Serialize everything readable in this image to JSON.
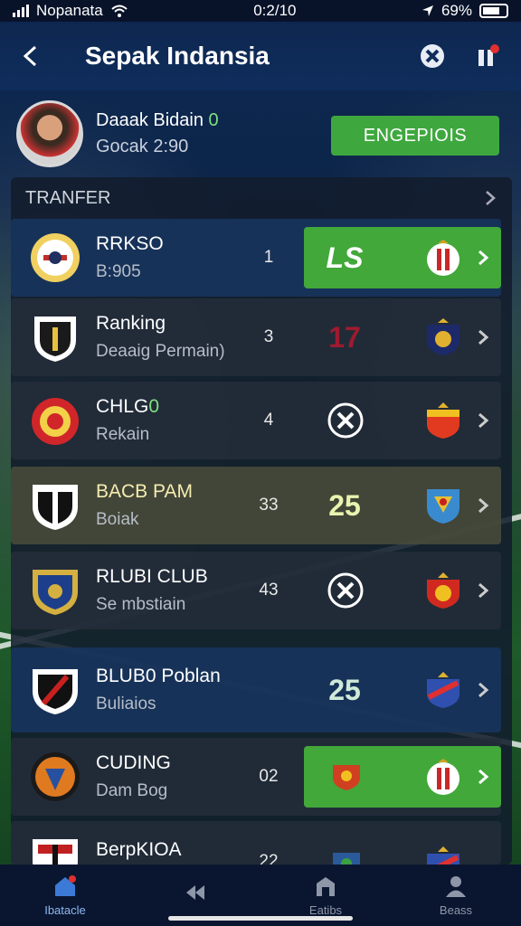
{
  "status_bar": {
    "carrier": "Nopanata",
    "time": "0:2/10",
    "battery": "69%"
  },
  "header": {
    "title": "Sepak Indansia"
  },
  "profile": {
    "name_main": "Daaak Bidain",
    "name_accent": "0",
    "subtitle": "Gocak 2:90",
    "action_label": "ENGEPIOIS"
  },
  "section": {
    "title": "TRANFER"
  },
  "rows": [
    {
      "name": "RRKSO",
      "sub": "B:905",
      "rank": "1",
      "result_type": "score",
      "score": "LS",
      "highlight": "green",
      "style": "blue"
    },
    {
      "name": "Ranking",
      "sub": "Deaaig Permain)",
      "rank": "3",
      "result_type": "score",
      "score": "17",
      "highlight": "none",
      "style": "dark"
    },
    {
      "name": "CHLG",
      "name_accent": "0",
      "sub": "Rekain",
      "rank": "4",
      "result_type": "tool",
      "highlight": "none",
      "style": "dark"
    },
    {
      "name": "BACB PAM",
      "sub": "Boiak",
      "rank": "33",
      "result_type": "score",
      "score": "25",
      "highlight": "none",
      "style": "olive"
    },
    {
      "name": "RLUBI CLUB",
      "sub": "Se mbstiain",
      "rank": "43",
      "result_type": "tool",
      "highlight": "none",
      "style": "dark"
    },
    {
      "name": "BLUB0 Poblan",
      "sub": "Buliaios",
      "rank": "",
      "result_type": "score",
      "score": "25",
      "highlight": "none",
      "style": "blue"
    },
    {
      "name": "CUDING",
      "sub": "Dam Bog",
      "rank": "02",
      "result_type": "crest",
      "highlight": "green",
      "style": "dark"
    },
    {
      "name": "BerpKIOA",
      "sub": "",
      "rank": "22",
      "result_type": "crest",
      "highlight": "none",
      "style": "dark"
    }
  ],
  "bottom_nav": [
    {
      "label": "Ibatacle",
      "icon": "home-icon",
      "active": true
    },
    {
      "label": "",
      "icon": "rewind-icon",
      "active": false
    },
    {
      "label": "Eatibs",
      "icon": "shop-icon",
      "active": false
    },
    {
      "label": "Beass",
      "icon": "person-icon",
      "active": false
    }
  ],
  "colors": {
    "accent_green": "#42a83a",
    "header_blue": "#0f2d5c",
    "panel": "#121c2c"
  }
}
